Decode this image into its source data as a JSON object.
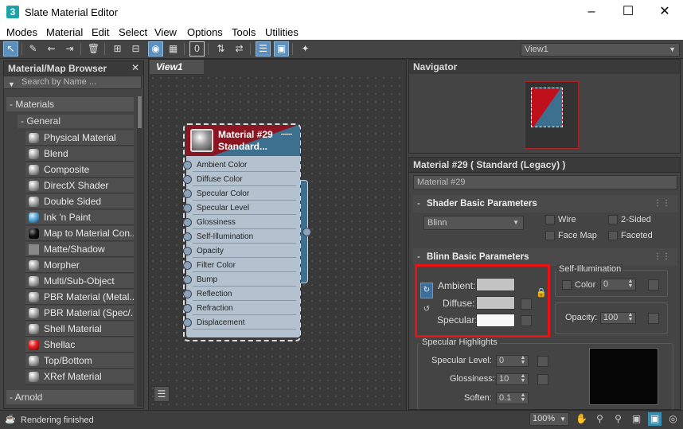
{
  "window": {
    "title": "Slate Material Editor",
    "app_icon": "3"
  },
  "menu": [
    "Modes",
    "Material",
    "Edit",
    "Select",
    "View",
    "Options",
    "Tools",
    "Utilities"
  ],
  "view_selector": "View1",
  "browser": {
    "title": "Material/Map Browser",
    "search_placeholder": "Search by Name ...",
    "categories": {
      "materials": "- Materials",
      "general": "- General",
      "arnold": "- Arnold"
    },
    "items": [
      "Physical Material",
      "Blend",
      "Composite",
      "DirectX Shader",
      "Double Sided",
      "Ink 'n Paint",
      "Map to Material Con...",
      "Matte/Shadow",
      "Morpher",
      "Multi/Sub-Object",
      "PBR Material (Metal...",
      "PBR Material (Spec/...",
      "Shell Material",
      "Shellac",
      "Top/Bottom",
      "XRef Material"
    ]
  },
  "view": {
    "tab": "View1"
  },
  "node": {
    "title_line1": "Material #29",
    "title_line2": "Standard...",
    "slots": [
      "Ambient Color",
      "Diffuse Color",
      "Specular Color",
      "Specular Level",
      "Glossiness",
      "Self-Illumination",
      "Opacity",
      "Filter Color",
      "Bump",
      "Reflection",
      "Refraction",
      "Displacement"
    ]
  },
  "navigator": {
    "title": "Navigator"
  },
  "params": {
    "header": "Material #29  ( Standard (Legacy) )",
    "material_name": "Material #29",
    "shader_rollout": "Shader Basic Parameters",
    "shader_type": "Blinn",
    "wire": "Wire",
    "two_sided": "2-Sided",
    "face_map": "Face Map",
    "faceted": "Faceted",
    "blinn_rollout": "Blinn Basic Parameters",
    "ambient": "Ambient:",
    "diffuse": "Diffuse:",
    "specular": "Specular:",
    "self_illum_group": "Self-Illumination",
    "color_label": "Color",
    "color_value": "0",
    "opacity_label": "Opacity:",
    "opacity_value": "100",
    "spec_group": "Specular Highlights",
    "spec_level_label": "Specular Level:",
    "spec_level_value": "0",
    "glossiness_label": "Glossiness:",
    "glossiness_value": "10",
    "soften_label": "Soften:",
    "soften_value": "0.1"
  },
  "colors": {
    "ambient": "#c4c4c4",
    "diffuse": "#c4c4c4",
    "specular": "#f8f8f8",
    "highlight_curve_bg": "#050505",
    "accent": "#5b8fbd",
    "annotation": "#e11111"
  },
  "status": {
    "text": "Rendering finished",
    "zoom": "100%"
  }
}
